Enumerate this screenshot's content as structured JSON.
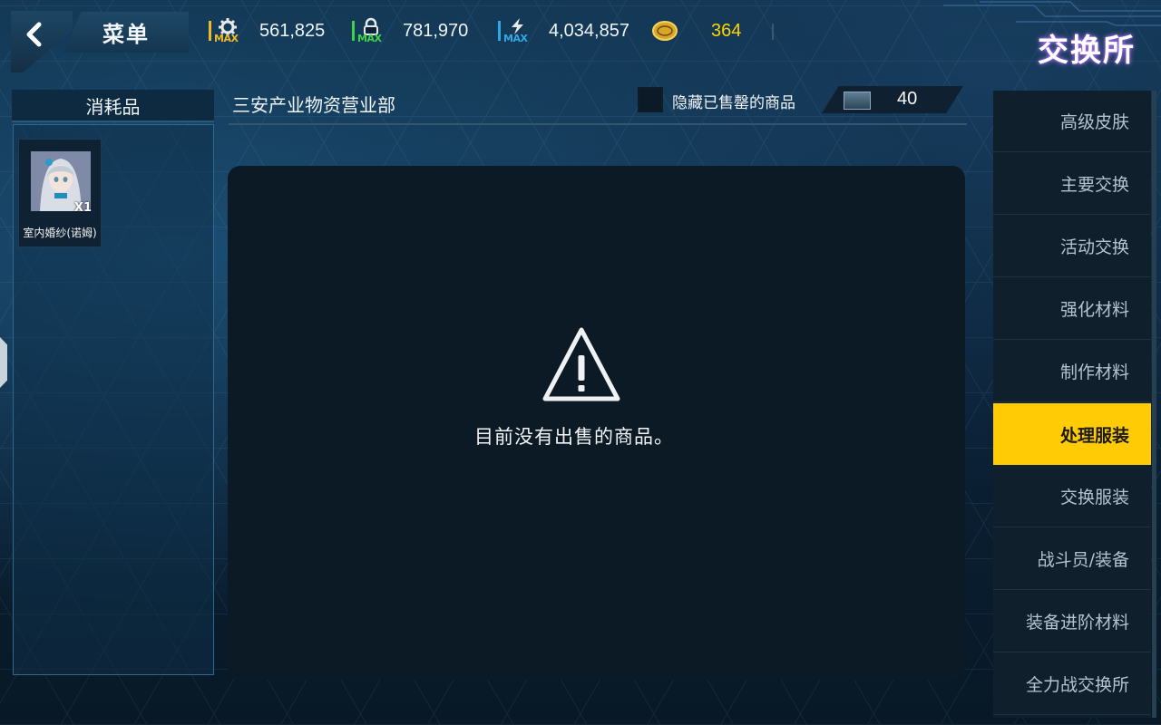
{
  "header": {
    "menu_label": "菜单",
    "title": "交换所",
    "resources": [
      {
        "icon": "gear-resource-icon",
        "max_label": "MAX",
        "value": "561,825",
        "color": "#f2b82b"
      },
      {
        "icon": "lock-resource-icon",
        "max_label": "MAX",
        "value": "781,970",
        "color": "#3fd24a"
      },
      {
        "icon": "lightning-resource-icon",
        "max_label": "MAX",
        "value": "4,034,857",
        "color": "#2fa8e6"
      }
    ],
    "currency": {
      "icon": "gold-coin-icon",
      "value": "364",
      "color": "#ffd400"
    }
  },
  "sidebar_left": {
    "heading": "消耗品",
    "items": [
      {
        "name": "室内婚纱(诺姆)",
        "quantity": "X1"
      }
    ]
  },
  "main": {
    "department": "三安产业物资营业部",
    "hide_sold_label": "隐藏已售罄的商品",
    "hide_sold_checked": false,
    "token_value": "40",
    "empty_message": "目前没有出售的商品。"
  },
  "tabs": [
    {
      "label": "高级皮肤",
      "active": false
    },
    {
      "label": "主要交换",
      "active": false
    },
    {
      "label": "活动交换",
      "active": false
    },
    {
      "label": "强化材料",
      "active": false
    },
    {
      "label": "制作材料",
      "active": false
    },
    {
      "label": "处理服装",
      "active": true
    },
    {
      "label": "交换服装",
      "active": false
    },
    {
      "label": "战斗员/装备",
      "active": false
    },
    {
      "label": "装备进阶材料",
      "active": false
    },
    {
      "label": "全力战交换所",
      "active": false
    }
  ],
  "colors": {
    "accent": "#ffcb05",
    "title_glow": "#c07cff"
  }
}
